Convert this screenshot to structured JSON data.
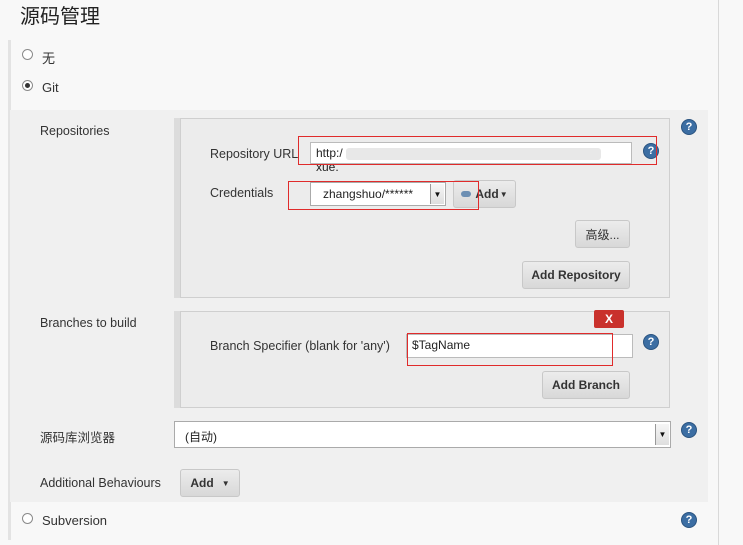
{
  "section_title": "源码管理",
  "scm_options": [
    {
      "label": "无",
      "checked": false
    },
    {
      "label": "Git",
      "checked": true
    },
    {
      "label": "Subversion",
      "checked": false
    }
  ],
  "repositories": {
    "label": "Repositories",
    "url_label": "Repository URL",
    "url_value_start": "http:/",
    "url_value_end": "xue.",
    "credentials_label": "Credentials",
    "credentials_value": "zhangshuo/******",
    "add_label": "Add",
    "advanced_label": "高级...",
    "add_repository_label": "Add Repository"
  },
  "branches": {
    "label": "Branches to build",
    "close_label": "X",
    "specifier_label": "Branch Specifier (blank for 'any')",
    "specifier_value": "$TagName",
    "add_branch_label": "Add Branch"
  },
  "browser": {
    "label": "源码库浏览器",
    "value": "(自动)"
  },
  "additional": {
    "label": "Additional Behaviours",
    "add_label": "Add"
  },
  "help_glyph": "?",
  "colors": {
    "highlight": "#e02b2b",
    "help": "#3c6ea3",
    "delete": "#c9312c"
  }
}
